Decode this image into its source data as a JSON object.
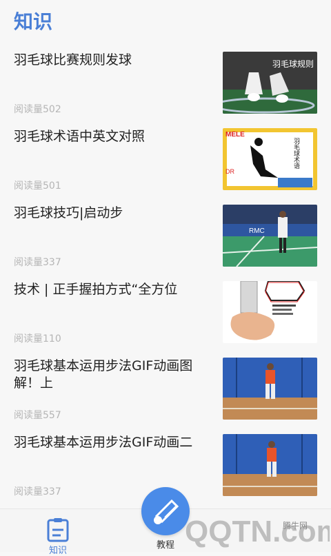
{
  "header": {
    "title": "知识"
  },
  "articles": [
    {
      "title": "羽毛球比赛规则发球",
      "reads": "阅读量502",
      "thumb_text": "羽毛球规则"
    },
    {
      "title": "羽毛球术语中英文对照",
      "reads": "阅读量501",
      "thumb_text": "羽毛球术语",
      "thumb_text2": "MELE",
      "thumb_text3": "DR"
    },
    {
      "title": "羽毛球技巧|启动步",
      "reads": "阅读量337",
      "thumb_text": "RMC"
    },
    {
      "title": "技术 | 正手握拍方式“全方位",
      "reads": "阅读量110"
    },
    {
      "title": "羽毛球基本运用步法GIF动画图解！上",
      "reads": "阅读量557"
    },
    {
      "title": "羽毛球基本运用步法GIF动画二",
      "reads": "阅读量337"
    }
  ],
  "tabbar": {
    "knowledge_label": "知识",
    "tutorial_label": "教程",
    "knowledge_icon": "clipboard-icon",
    "tutorial_icon": "shuttlecock-icon"
  },
  "watermark": {
    "site": "腾牛网",
    "brand": "QQTN.com"
  },
  "colors": {
    "accent": "#4a7fd6",
    "fab": "#4a8be8",
    "court_green": "#2e8a5a",
    "court_blue": "#1f5fa8"
  }
}
